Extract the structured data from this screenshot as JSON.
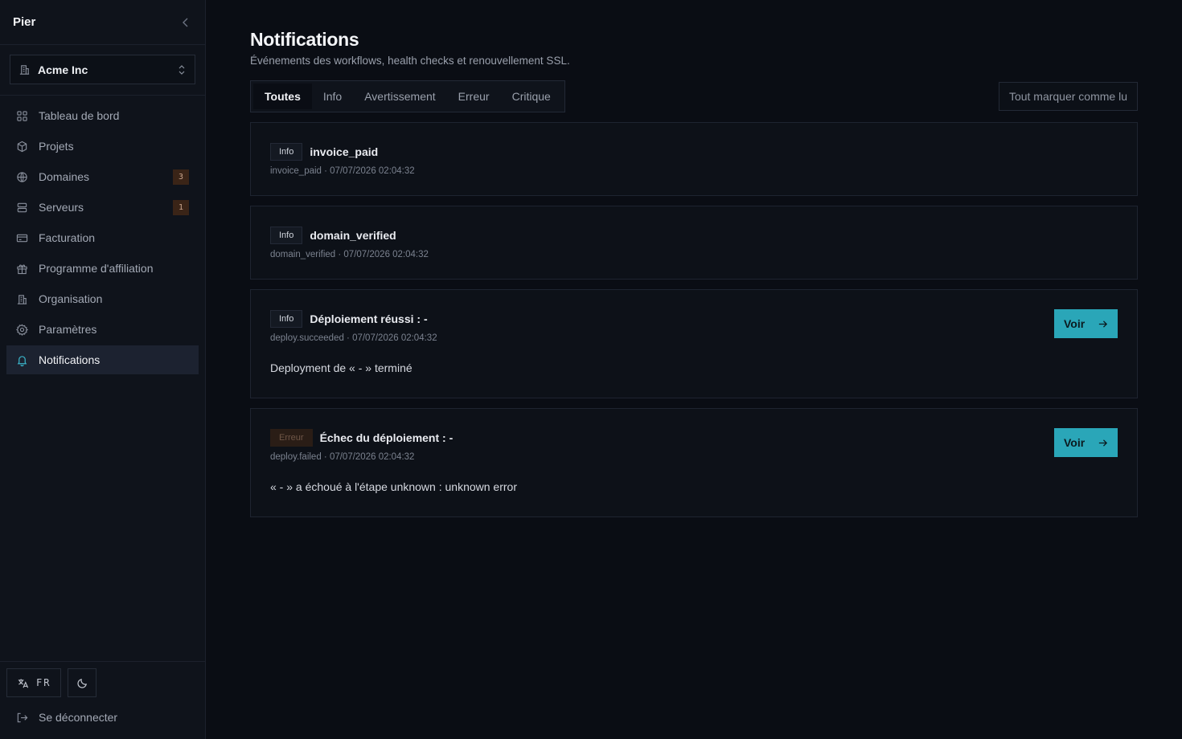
{
  "sidebar": {
    "brand": "Pier",
    "org_name": "Acme Inc",
    "items": [
      {
        "label": "Tableau de bord",
        "icon": "grid-icon"
      },
      {
        "label": "Projets",
        "icon": "box-icon"
      },
      {
        "label": "Domaines",
        "icon": "globe-icon",
        "badge": "3"
      },
      {
        "label": "Serveurs",
        "icon": "server-icon",
        "badge": "1"
      },
      {
        "label": "Facturation",
        "icon": "credit-card-icon"
      },
      {
        "label": "Programme d'affiliation",
        "icon": "gift-icon"
      },
      {
        "label": "Organisation",
        "icon": "building-icon"
      },
      {
        "label": "Paramètres",
        "icon": "gear-icon"
      },
      {
        "label": "Notifications",
        "icon": "bell-icon",
        "active": true
      }
    ],
    "language": "FR",
    "logout_label": "Se déconnecter"
  },
  "header": {
    "title": "Notifications",
    "subtitle": "Événements des workflows, health checks et renouvellement SSL."
  },
  "tabs": [
    "Toutes",
    "Info",
    "Avertissement",
    "Erreur",
    "Critique"
  ],
  "active_tab": "Toutes",
  "mark_all_label": "Tout marquer comme lu",
  "notifications": [
    {
      "severity": "Info",
      "title": "invoice_paid",
      "meta": "invoice_paid · 07/07/2026 02:04:32"
    },
    {
      "severity": "Info",
      "title": "domain_verified",
      "meta": "domain_verified · 07/07/2026 02:04:32"
    },
    {
      "severity": "Info",
      "title": "Déploiement réussi : -",
      "meta": "deploy.succeeded · 07/07/2026 02:04:32",
      "description": "Deployment de « - » terminé",
      "action": "Voir"
    },
    {
      "severity": "Erreur",
      "title": "Échec du déploiement : -",
      "meta": "deploy.failed · 07/07/2026 02:04:32",
      "description": "« - » a échoué à l'étape unknown : unknown error",
      "action": "Voir"
    }
  ],
  "colors": {
    "accent": "#2aa6b8",
    "background": "#0a0d14",
    "sidebar": "#0f131b",
    "badge": "#3a2417"
  }
}
